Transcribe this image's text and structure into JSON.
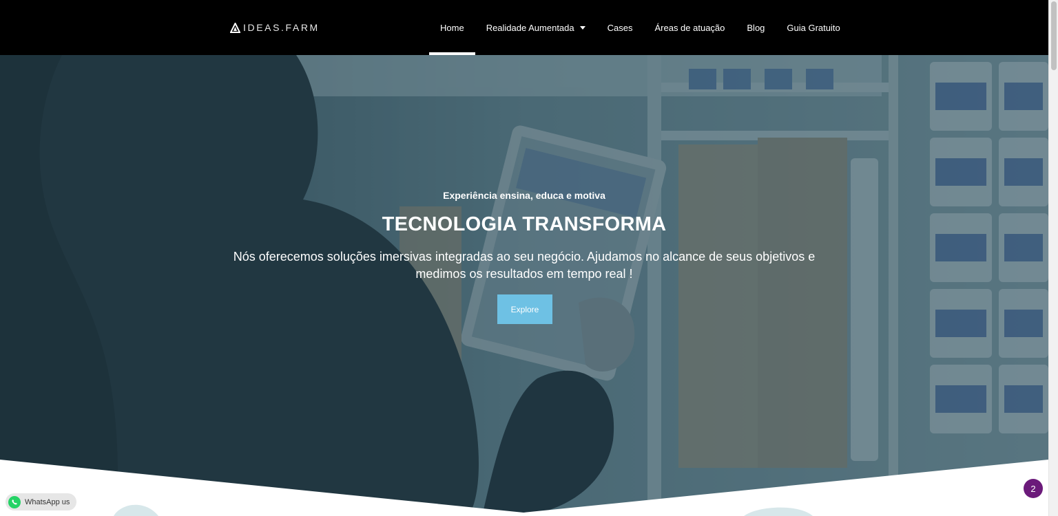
{
  "header": {
    "logo_text": "IDEAS.FARM",
    "nav": [
      {
        "label": "Home"
      },
      {
        "label": "Realidade Aumentada"
      },
      {
        "label": "Cases"
      },
      {
        "label": "Áreas de atuação"
      },
      {
        "label": "Blog"
      },
      {
        "label": "Guia Gratuito"
      }
    ]
  },
  "hero": {
    "eyebrow": "Experiência ensina, educa e motiva",
    "title": "TECNOLOGIA TRANSFORMA",
    "description": "Nós oferecemos soluções imersivas integradas ao seu negócio. Ajudamos no alcance de seus objetivos e medimos os resultados em tempo real !",
    "button_label": "Explore",
    "overlay_color": "#1c3c49",
    "accent_button_color": "#6ec1e4"
  },
  "widgets": {
    "whatsapp_label": "WhatsApp us",
    "badge_count": "2",
    "badge_color": "#6b1a7a"
  }
}
